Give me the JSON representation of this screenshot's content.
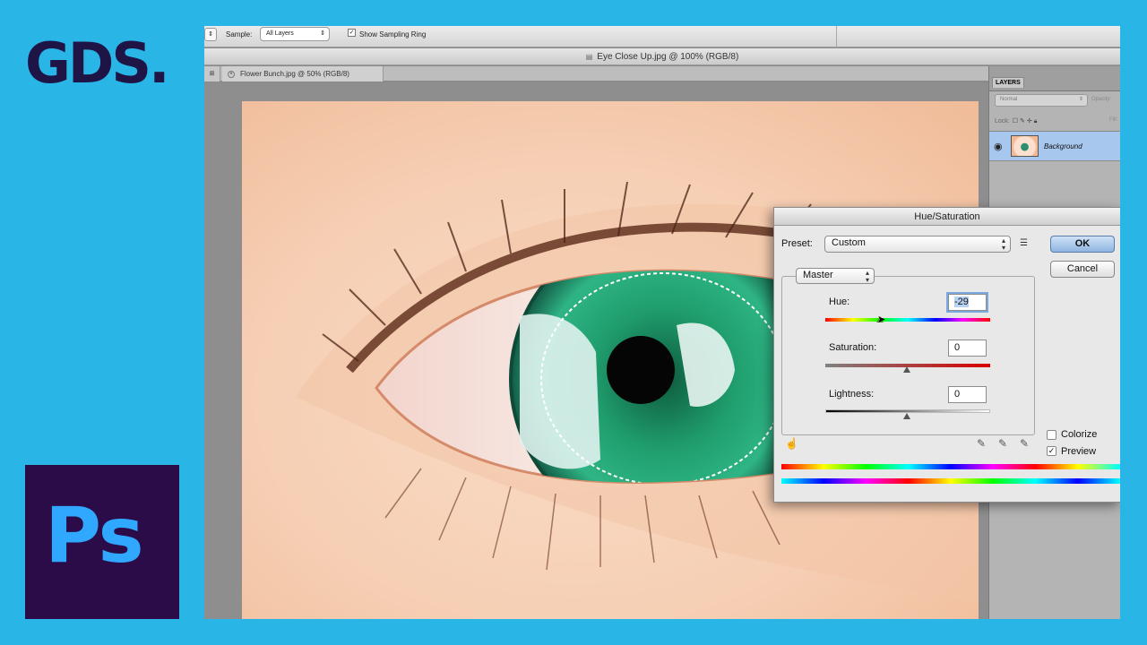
{
  "branding": {
    "gds_logo": "GDS.",
    "ps_logo": "Ps",
    "brand_bg": "#29b5e6",
    "ps_bg": "#2b0c49",
    "ps_fg": "#31a8ff"
  },
  "options_bar": {
    "sample_label": "Sample:",
    "sample_value": "All Layers",
    "show_ring_label": "Show Sampling Ring",
    "show_ring_checked": true
  },
  "window": {
    "title": "Eye Close Up.jpg @ 100% (RGB/8)"
  },
  "tabs": [
    {
      "label": "Flower Bunch.jpg @ 50% (RGB/8)"
    }
  ],
  "layers_panel": {
    "tab_label": "LAYERS",
    "blend_mode": "Normal",
    "opacity_label": "Opacity:",
    "lock_label": "Lock:",
    "fill_label": "Fill:",
    "layers": [
      {
        "name": "Background",
        "visible": true,
        "selected": true
      }
    ]
  },
  "hue_saturation": {
    "title": "Hue/Saturation",
    "preset_label": "Preset:",
    "preset_value": "Custom",
    "channel_value": "Master",
    "ok_label": "OK",
    "cancel_label": "Cancel",
    "hue_label": "Hue:",
    "hue_value": "-29",
    "saturation_label": "Saturation:",
    "saturation_value": "0",
    "lightness_label": "Lightness:",
    "lightness_value": "0",
    "colorize_label": "Colorize",
    "colorize_checked": false,
    "preview_label": "Preview",
    "preview_checked": true
  }
}
